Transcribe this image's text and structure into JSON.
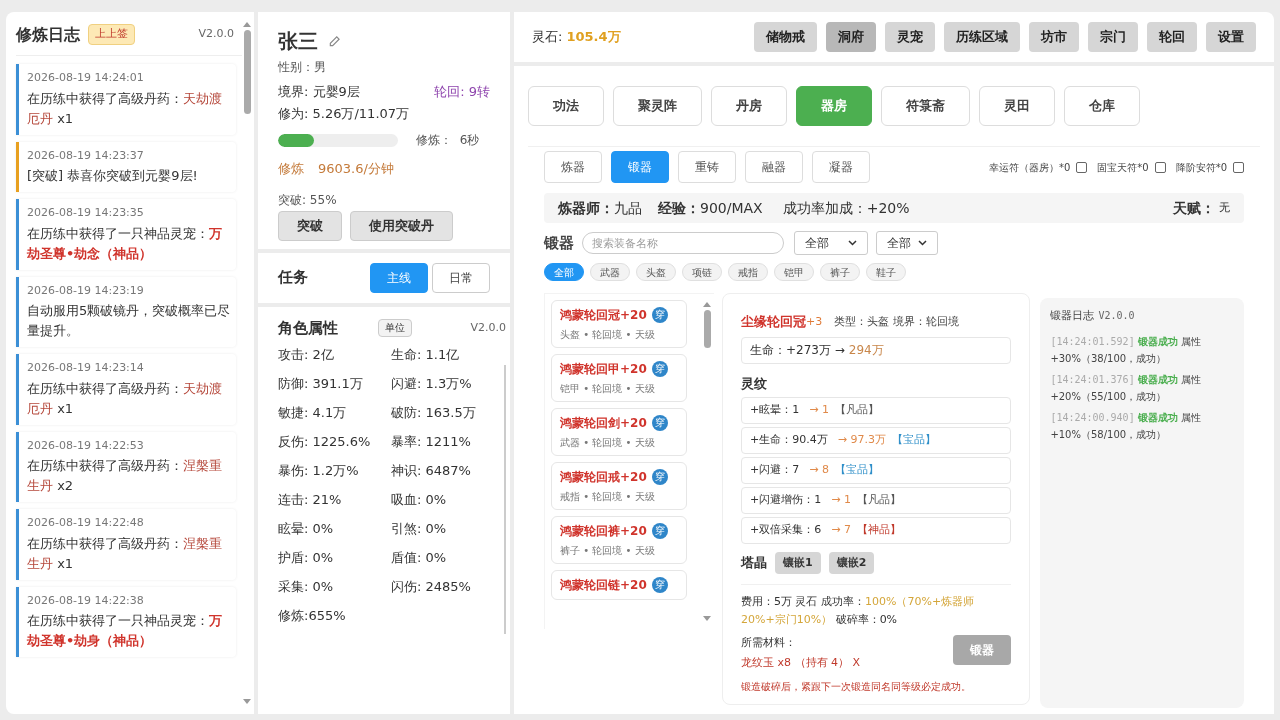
{
  "log": {
    "title": "修炼日志",
    "badge": "上上签",
    "version": "V2.0.0",
    "entries": [
      {
        "kind": "loot",
        "time": "2026-08-19 14:24:01",
        "text": "在历练中获得了高级丹药：",
        "highlight": {
          "text": "天劫渡厄丹",
          "kind": "item"
        },
        "suffix": " x1"
      },
      {
        "kind": "breakthrough",
        "time": "2026-08-19 14:23:37",
        "text": "[突破] 恭喜你突破到元婴9层!"
      },
      {
        "kind": "loot",
        "time": "2026-08-19 14:23:35",
        "text": "在历练中获得了一只神品灵宠：",
        "highlight": {
          "text": "万劫圣尊•劫念（神品）",
          "kind": "pet"
        }
      },
      {
        "kind": "loot",
        "time": "2026-08-19 14:23:19",
        "text": "自动服用5颗破镜丹，突破概率已尽量提升。"
      },
      {
        "kind": "loot",
        "time": "2026-08-19 14:23:14",
        "text": "在历练中获得了高级丹药：",
        "highlight": {
          "text": "天劫渡厄丹",
          "kind": "item"
        },
        "suffix": " x1"
      },
      {
        "kind": "loot",
        "time": "2026-08-19 14:22:53",
        "text": "在历练中获得了高级丹药：",
        "highlight": {
          "text": "涅槃重生丹",
          "kind": "item"
        },
        "suffix": " x2"
      },
      {
        "kind": "loot",
        "time": "2026-08-19 14:22:48",
        "text": "在历练中获得了高级丹药：",
        "highlight": {
          "text": "涅槃重生丹",
          "kind": "item"
        },
        "suffix": " x1"
      },
      {
        "kind": "loot",
        "time": "2026-08-19 14:22:38",
        "text": "在历练中获得了一只神品灵宠：",
        "highlight": {
          "text": "万劫圣尊•劫身（神品）",
          "kind": "pet"
        }
      }
    ]
  },
  "character": {
    "name": "张三",
    "gender": "性别：男",
    "realm": "境界: 元婴9层",
    "reincarnation": "轮回: 9转",
    "cultivation": "修为: 5.26万/11.07万",
    "progress": {
      "level": 0.3
    },
    "timer": "修炼：  6秒",
    "rate_label": "修炼",
    "rate": "9603.6/分钟",
    "breakthrough": "突破: 55%",
    "buttons": [
      "突破",
      "使用突破丹"
    ]
  },
  "tasks": {
    "title": "任务",
    "tabs": [
      {
        "label": "主线",
        "selected": true
      },
      {
        "label": "日常",
        "selected": false
      }
    ]
  },
  "attributes": {
    "title": "角色属性",
    "unit_button": "单位",
    "version": "V2.0.0",
    "items": [
      "攻击: 2亿",
      "生命: 1.1亿",
      "防御: 391.1万",
      "闪避: 1.3万%",
      "敏捷: 4.1万",
      "破防: 163.5万",
      "反伤: 1225.6%",
      "暴率: 1211%",
      "暴伤: 1.2万%",
      "神识: 6487%",
      "连击: 21%",
      "吸血: 0%",
      "眩晕: 0%",
      "引煞: 0%",
      "护盾: 0%",
      "盾值: 0%",
      "采集: 0%",
      "闪伤: 2485%",
      "修炼:655%"
    ]
  },
  "top": {
    "currency_label": "灵石:",
    "currency": "105.4万",
    "nav": [
      {
        "label": "储物戒",
        "selected": false
      },
      {
        "label": "洞府",
        "selected": true
      },
      {
        "label": "灵宠",
        "selected": false
      },
      {
        "label": "历练区域",
        "selected": false
      },
      {
        "label": "坊市",
        "selected": false
      },
      {
        "label": "宗门",
        "selected": false
      },
      {
        "label": "轮回",
        "selected": false
      },
      {
        "label": "设置",
        "selected": false
      }
    ]
  },
  "buildings": [
    {
      "label": "功法",
      "selected": false
    },
    {
      "label": "聚灵阵",
      "selected": false
    },
    {
      "label": "丹房",
      "selected": false
    },
    {
      "label": "器房",
      "selected": true
    },
    {
      "label": "符箓斋",
      "selected": false
    },
    {
      "label": "灵田",
      "selected": false
    },
    {
      "label": "仓库",
      "selected": false
    }
  ],
  "forge": {
    "tabs": [
      {
        "label": "炼器",
        "selected": false
      },
      {
        "label": "锻器",
        "selected": true
      },
      {
        "label": "重铸",
        "selected": false
      },
      {
        "label": "融器",
        "selected": false
      },
      {
        "label": "凝器",
        "selected": false
      }
    ],
    "charms": [
      {
        "label": "幸运符（器房）*0",
        "checked": false
      },
      {
        "label": "固宝天符*0",
        "checked": false
      },
      {
        "label": "降阶安符*0",
        "checked": false
      }
    ],
    "info": {
      "master_label": "炼器师：",
      "master": "九品",
      "exp_label": "经验：",
      "exp": "900/MAX",
      "bonus": "成功率加成：+20%",
      "talent_label": "天赋：",
      "talent": "无"
    },
    "title": "锻器",
    "search": {
      "placeholder": "搜索装备名称"
    },
    "selects": [
      "全部",
      "全部"
    ],
    "filters": [
      {
        "label": "全部",
        "selected": true
      },
      {
        "label": "武器",
        "selected": false
      },
      {
        "label": "头盔",
        "selected": false
      },
      {
        "label": "项链",
        "selected": false
      },
      {
        "label": "戒指",
        "selected": false
      },
      {
        "label": "铠甲",
        "selected": false
      },
      {
        "label": "裤子",
        "selected": false
      },
      {
        "label": "鞋子",
        "selected": false
      }
    ],
    "equipment": [
      {
        "name": "鸿蒙轮回冠+20",
        "badge": "穿",
        "meta": "头盔 • 轮回境 • 天级"
      },
      {
        "name": "鸿蒙轮回甲+20",
        "badge": "穿",
        "meta": "铠甲 • 轮回境 • 天级"
      },
      {
        "name": "鸿蒙轮回剑+20",
        "badge": "穿",
        "meta": "武器 • 轮回境 • 天级"
      },
      {
        "name": "鸿蒙轮回戒+20",
        "badge": "穿",
        "meta": "戒指 • 轮回境 • 天级"
      },
      {
        "name": "鸿蒙轮回裤+20",
        "badge": "穿",
        "meta": "裤子 • 轮回境 • 天级"
      },
      {
        "name": "鸿蒙轮回链+20",
        "badge": "穿"
      }
    ],
    "detail": {
      "name": "尘缘轮回冠",
      "level": "+3",
      "meta": "类型：头盔 境界：轮回境",
      "base": "生命：+273万 →",
      "base_to": "294万",
      "runes_title": "灵纹",
      "runes": [
        {
          "label": "+眩晕：1",
          "to": "→ 1",
          "grade": {
            "text": "【凡品】",
            "kind": "common"
          }
        },
        {
          "label": "+生命：90.4万",
          "to": "→ 97.3万",
          "grade": {
            "text": "【宝品】",
            "kind": "treasure"
          }
        },
        {
          "label": "+闪避：7",
          "to": "→ 8",
          "grade": {
            "text": "【宝品】",
            "kind": "treasure"
          }
        },
        {
          "label": "+闪避增伤：1",
          "to": "→ 1",
          "grade": {
            "text": "【凡品】",
            "kind": "common"
          }
        },
        {
          "label": "+双倍采集：6",
          "to": "→ 7",
          "grade": {
            "text": "【神品】",
            "kind": "divine"
          }
        }
      ],
      "crystal_title": "塔晶",
      "inlays": [
        "镶嵌1",
        "镶嵌2"
      ],
      "cost": "费用：5万 灵石 成功率：",
      "rate": "100%（70%+炼器师20%+宗门10%）",
      "break_rate": "破碎率：0%",
      "materials_label": "所需材料：",
      "material": "龙纹玉 x8 （持有 4） X",
      "forge_button": {
        "label": "锻器",
        "disabled": true
      },
      "note": "锻造破碎后，紧跟下一次锻造同名同等级必定成功。"
    }
  },
  "forge_log": {
    "title": "锻器日志",
    "version": "V2.0.0",
    "entries": [
      {
        "time": "[14:24:01.592]",
        "result": "锻器成功",
        "text": "属性 +30%（38/100，成功）"
      },
      {
        "time": "[14:24:01.376]",
        "result": "锻器成功",
        "text": "属性 +20%（55/100，成功）"
      },
      {
        "time": "[14:24:00.940]",
        "result": "锻器成功",
        "text": "属性 +10%（58/100，成功）"
      }
    ]
  }
}
